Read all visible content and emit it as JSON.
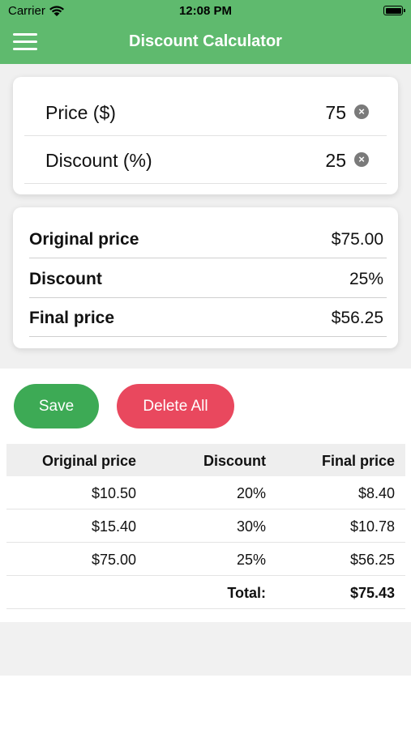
{
  "status_bar": {
    "carrier": "Carrier",
    "time": "12:08 PM"
  },
  "header": {
    "title": "Discount Calculator",
    "menu_icon": "hamburger-menu-icon"
  },
  "inputs": [
    {
      "label": "Price ($)",
      "value": "75"
    },
    {
      "label": "Discount (%)",
      "value": "25"
    }
  ],
  "results": [
    {
      "label": "Original price",
      "value": "$75.00"
    },
    {
      "label": "Discount",
      "value": "25%"
    },
    {
      "label": "Final price",
      "value": "$56.25"
    }
  ],
  "buttons": {
    "save": "Save",
    "delete_all": "Delete All"
  },
  "table": {
    "headers": [
      "Original price",
      "Discount",
      "Final price"
    ],
    "rows": [
      [
        "$10.50",
        "20%",
        "$8.40"
      ],
      [
        "$15.40",
        "30%",
        "$10.78"
      ],
      [
        "$75.00",
        "25%",
        "$56.25"
      ]
    ],
    "total_label": "Total:",
    "total_value": "$75.43"
  },
  "colors": {
    "header": "#5fba6e",
    "save": "#3daa55",
    "delete": "#e9485e"
  }
}
